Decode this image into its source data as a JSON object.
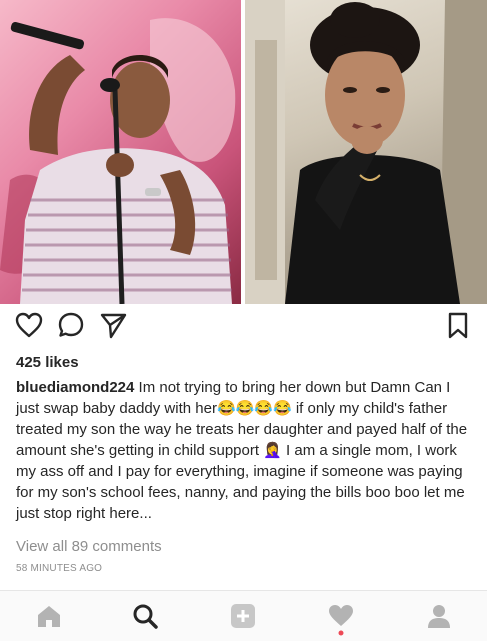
{
  "post": {
    "likes": "425 likes",
    "username": "bluediamond224",
    "caption": " Im not trying to bring her down but Damn Can I just swap baby daddy with her😂😂😂😂 if only my child's father treated my son the way he treats her daughter and payed half of the amount she's getting in child support 🤦‍♀️ I am a single mom, I work my ass off and I pay for everything, imagine if someone was paying for my son's school fees, nanny, and paying the bills boo boo let me just stop right here...",
    "view_comments": "View all 89 comments",
    "timestamp": "58 MINUTES AGO"
  },
  "icons": {
    "like": "heart-icon",
    "comment": "comment-icon",
    "share": "send-icon",
    "save": "bookmark-icon"
  },
  "tabs": [
    {
      "name": "home",
      "icon": "home-icon"
    },
    {
      "name": "search",
      "icon": "search-icon"
    },
    {
      "name": "new post",
      "icon": "plus-icon"
    },
    {
      "name": "activity",
      "icon": "heart-icon",
      "has_notification": true
    },
    {
      "name": "profile",
      "icon": "profile-icon"
    }
  ],
  "colors": {
    "notification_dot": "#ed4956",
    "tab_active": "#262626",
    "tab_inactive": "#b3b3b3"
  }
}
